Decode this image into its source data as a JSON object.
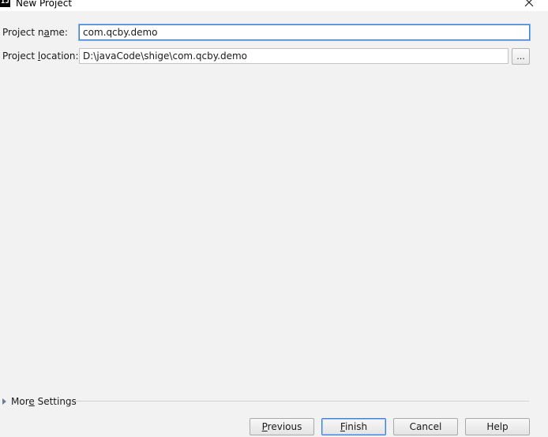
{
  "window": {
    "title": "New Project",
    "app_icon_text": "IJ"
  },
  "form": {
    "project_name": {
      "label_pre": "Project n",
      "label_mnemonic": "a",
      "label_post": "me:",
      "value": "com.qcby.demo"
    },
    "project_location": {
      "label_pre": "Project ",
      "label_mnemonic": "l",
      "label_post": "ocation:",
      "value": "D:\\javaCode\\shige\\com.qcby.demo",
      "browse_label": "..."
    }
  },
  "more_settings": {
    "label_pre": "Mor",
    "label_mnemonic": "e",
    "label_post": " Settings"
  },
  "buttons": {
    "previous": {
      "mnemonic": "P",
      "rest": "revious"
    },
    "finish": {
      "mnemonic": "F",
      "rest": "inish"
    },
    "cancel": {
      "label": "Cancel"
    },
    "help": {
      "label": "Help"
    }
  },
  "colors": {
    "background": "#f2f2f2",
    "focus_border": "#3d7fd4",
    "input_border": "#c4c4c4"
  }
}
